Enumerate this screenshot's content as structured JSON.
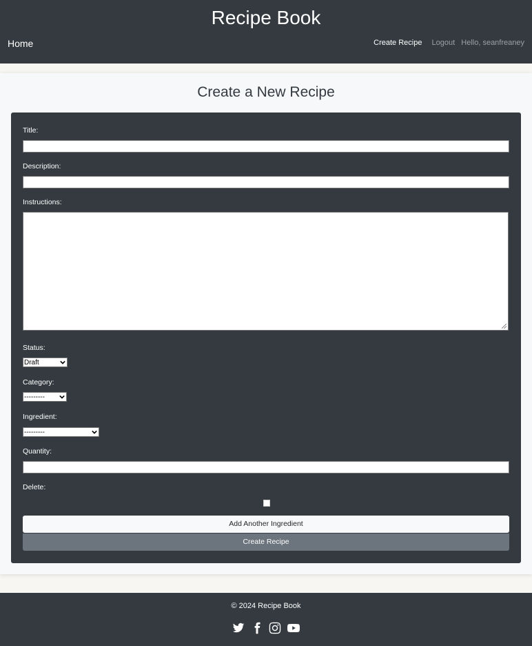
{
  "navbar": {
    "brand": "Recipe Book",
    "home_label": "Home",
    "create_label": "Create Recipe",
    "logout_label": "Logout",
    "user_greeting": "Hello, seanfreaney"
  },
  "page": {
    "title": "Create a New Recipe"
  },
  "form": {
    "title_label": "Title:",
    "title_value": "",
    "description_label": "Description:",
    "description_value": "",
    "instructions_label": "Instructions:",
    "instructions_value": "",
    "status_label": "Status:",
    "status_value": "Draft",
    "category_label": "Category:",
    "category_value": "---------",
    "ingredient_label": "Ingredient:",
    "ingredient_value": "---------",
    "quantity_label": "Quantity:",
    "quantity_value": "",
    "delete_label": "Delete:",
    "delete_checked": false,
    "add_ingredient_label": "Add Another Ingredient",
    "submit_label": "Create Recipe"
  },
  "footer": {
    "copyright": "© 2024 Recipe Book",
    "social_icons": [
      "twitter-icon",
      "facebook-icon",
      "instagram-icon",
      "youtube-icon"
    ]
  },
  "colors": {
    "dark": "#343a40",
    "secondary_button": "#6c757d",
    "light_button": "#f8f9fa",
    "page_bg": "#f8f6f3"
  }
}
